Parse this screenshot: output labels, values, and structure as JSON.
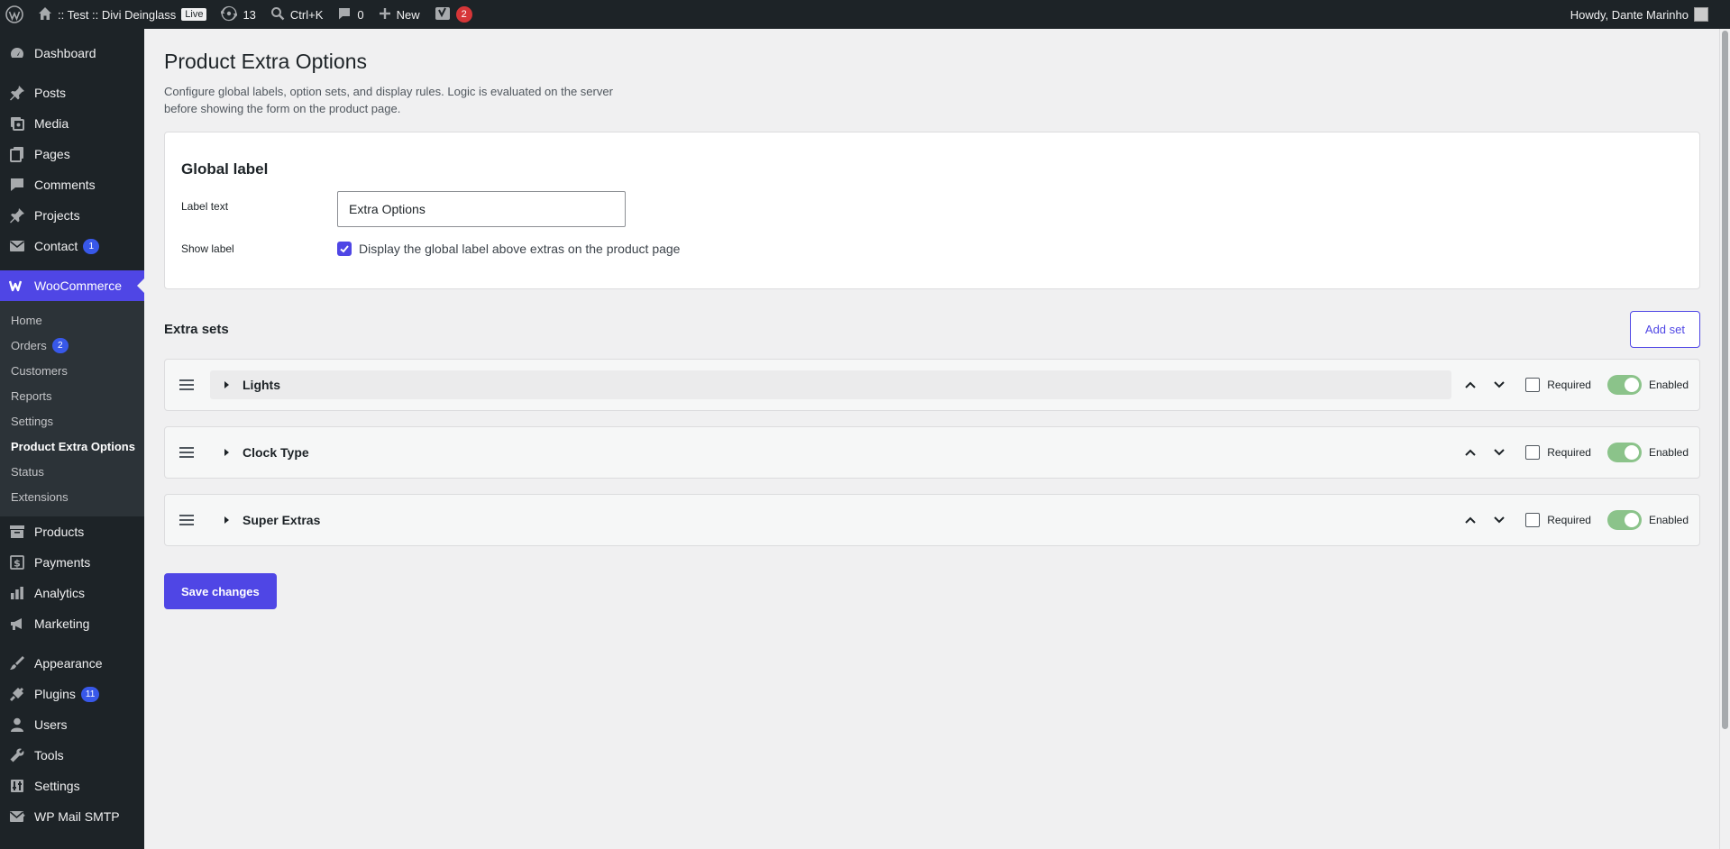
{
  "adminbar": {
    "site_name": ":: Test :: Divi Deinglass",
    "live_badge": "Live",
    "updates_count": "13",
    "search_shortcut": "Ctrl+K",
    "comments_count": "0",
    "new_label": "New",
    "yoast_count": "2",
    "greeting": "Howdy, Dante Marinho"
  },
  "sidebar": {
    "dashboard": "Dashboard",
    "posts": "Posts",
    "media": "Media",
    "pages": "Pages",
    "comments": "Comments",
    "projects": "Projects",
    "contact": "Contact",
    "contact_count": "1",
    "woocommerce": "WooCommerce",
    "woo_sub": {
      "home": "Home",
      "orders": "Orders",
      "orders_count": "2",
      "customers": "Customers",
      "reports": "Reports",
      "settings": "Settings",
      "product_extra_options": "Product Extra Options",
      "status": "Status",
      "extensions": "Extensions"
    },
    "products": "Products",
    "payments": "Payments",
    "analytics": "Analytics",
    "marketing": "Marketing",
    "appearance": "Appearance",
    "plugins": "Plugins",
    "plugins_count": "11",
    "users": "Users",
    "tools": "Tools",
    "settings": "Settings",
    "wp_mail_smtp": "WP Mail SMTP"
  },
  "page": {
    "title": "Product Extra Options",
    "description": "Configure global labels, option sets, and display rules. Logic is evaluated on the server before showing the form on the product page."
  },
  "global_label": {
    "heading": "Global label",
    "label_text_label": "Label text",
    "label_text_value": "Extra Options",
    "show_label_label": "Show label",
    "show_label_checkbox_text": "Display the global label above extras on the product page",
    "show_label_checked": true
  },
  "extra_sets": {
    "title": "Extra sets",
    "add_button": "Add set",
    "required_label": "Required",
    "enabled_label": "Enabled",
    "items": [
      {
        "name": "Lights",
        "required": false,
        "enabled": true
      },
      {
        "name": "Clock Type",
        "required": false,
        "enabled": true
      },
      {
        "name": "Super Extras",
        "required": false,
        "enabled": true
      }
    ]
  },
  "save_button": "Save changes",
  "colors": {
    "accent": "#4f46e5",
    "toggle_on": "#8bc38a",
    "sidebar_bg": "#1d2327"
  }
}
